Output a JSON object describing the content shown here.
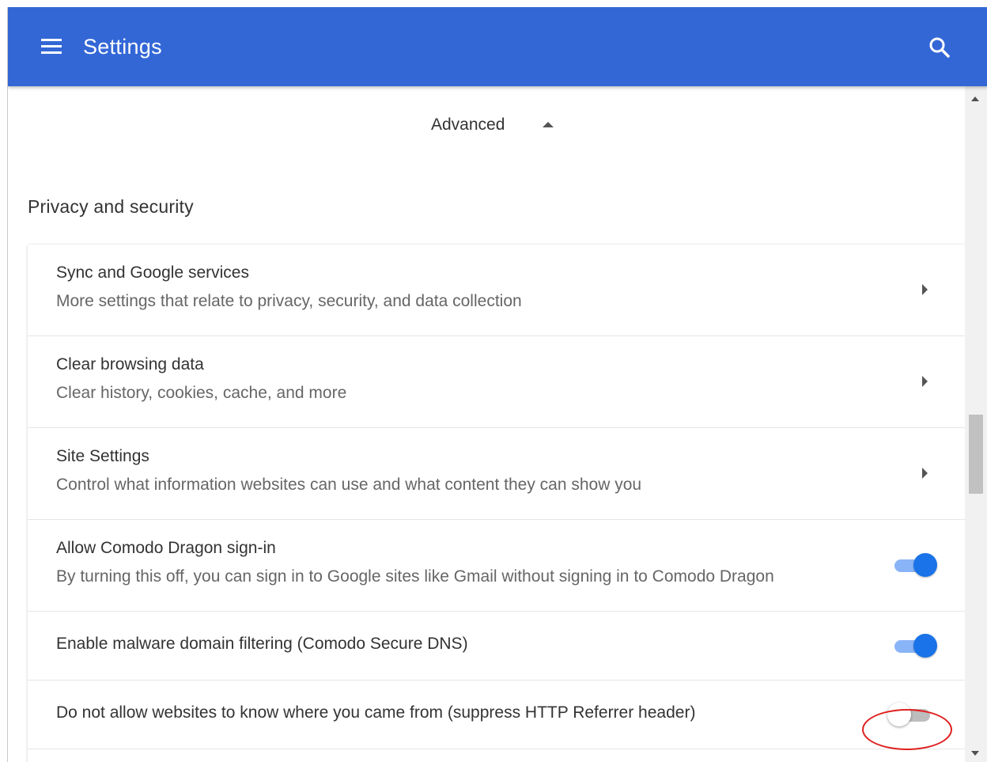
{
  "header": {
    "title": "Settings",
    "menu_icon": "hamburger-menu-icon",
    "search_icon": "search-icon",
    "background_color": "#3367d6"
  },
  "advanced": {
    "label": "Advanced",
    "icon": "caret-up-icon"
  },
  "section": {
    "title": "Privacy and security"
  },
  "rows": [
    {
      "title": "Sync and Google services",
      "subtitle": "More settings that relate to privacy, security, and data collection",
      "control": "chevron"
    },
    {
      "title": "Clear browsing data",
      "subtitle": "Clear history, cookies, cache, and more",
      "control": "chevron"
    },
    {
      "title": "Site Settings",
      "subtitle": "Control what information websites can use and what content they can show you",
      "control": "chevron"
    },
    {
      "title": "Allow Comodo Dragon sign-in",
      "subtitle": "By turning this off, you can sign in to Google sites like Gmail without signing in to Comodo Dragon",
      "control": "toggle",
      "enabled": true
    },
    {
      "title": "Enable malware domain filtering (Comodo Secure DNS)",
      "control": "toggle",
      "enabled": true,
      "highlighted": true
    },
    {
      "title": "Do not allow websites to know where you came from (suppress HTTP Referrer header)",
      "control": "toggle",
      "enabled": false
    }
  ],
  "colors": {
    "toggle_on_knob": "#1a73e8",
    "toggle_on_track": "#8ab4f8",
    "highlight_ring": "#e02020"
  }
}
